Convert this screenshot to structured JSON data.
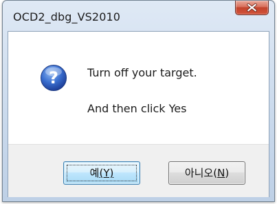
{
  "window": {
    "title": "OCD2_dbg_VS2010"
  },
  "message": {
    "line1": "Turn off your target.",
    "line2": "And then click Yes"
  },
  "icons": {
    "close": "close-icon",
    "info": "question-icon"
  },
  "buttons": {
    "yes_text": "예",
    "yes_mnemonic": "(Y)",
    "no_text": "아니오",
    "no_mnemonic": "(N)"
  },
  "colors": {
    "title_bar": "#c9d9ec",
    "close_button": "#c2432c",
    "question_icon": "#2f64c5",
    "footer": "#f0f0f0"
  }
}
